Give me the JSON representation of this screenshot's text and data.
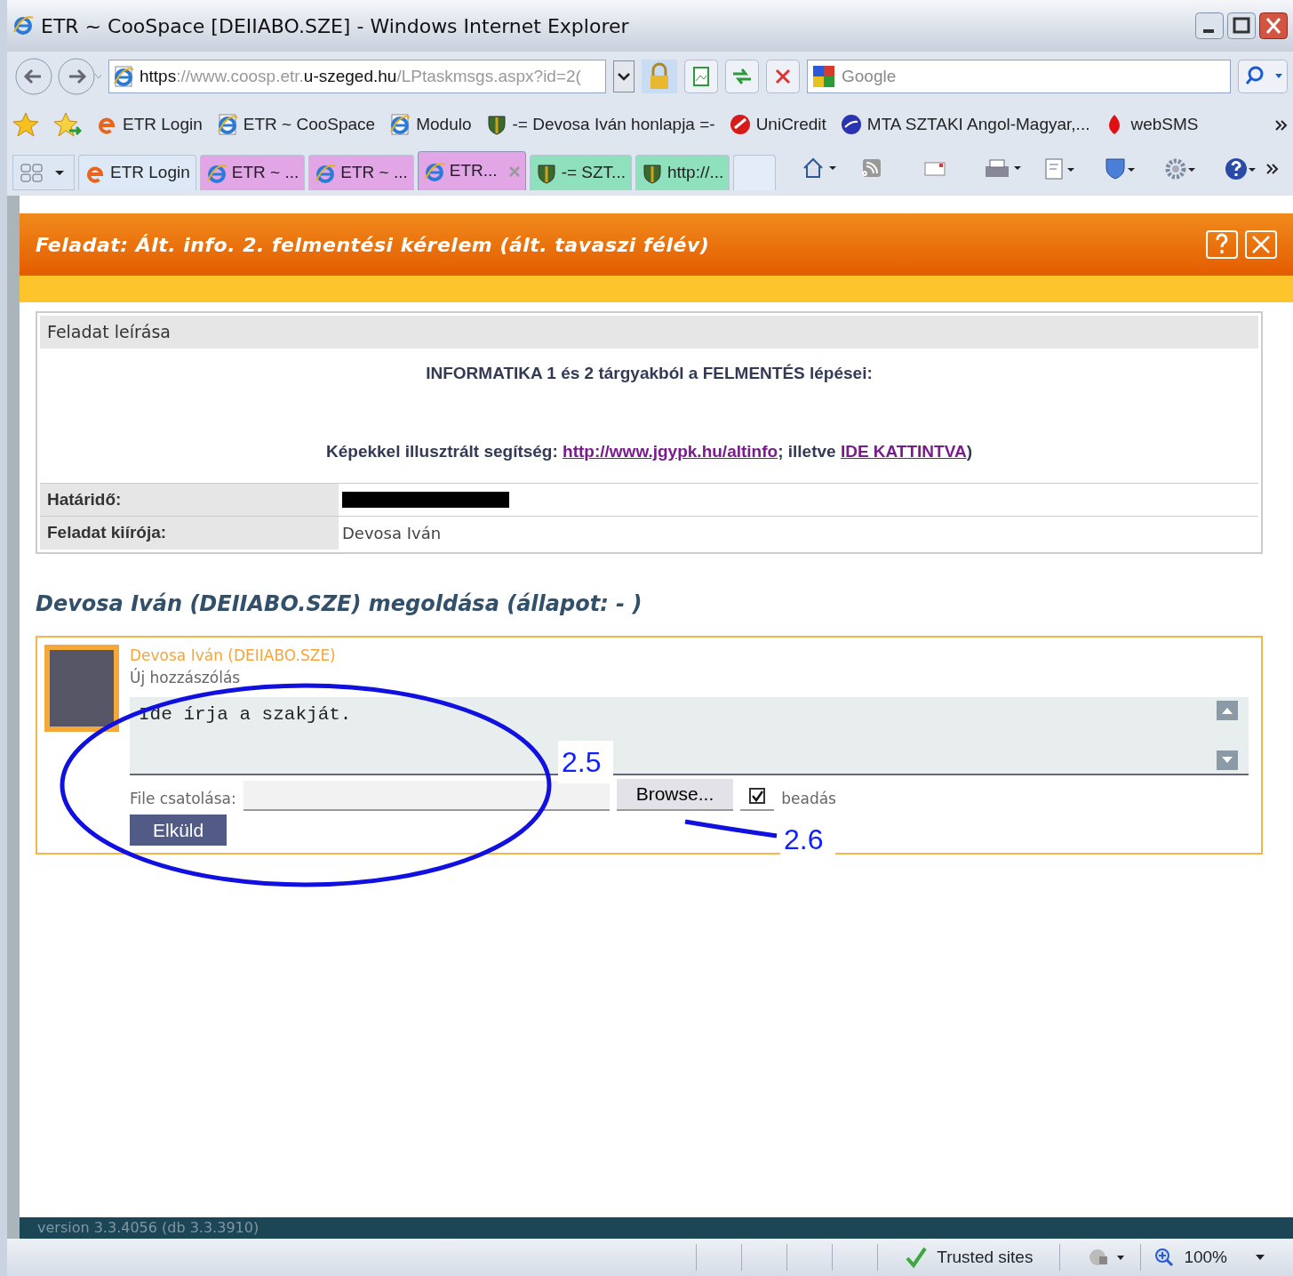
{
  "window": {
    "title": "ETR ~ CooSpace [DEIIABO.SZE] - Windows Internet Explorer"
  },
  "address": {
    "url_parts": [
      {
        "text": "https",
        "dim": false
      },
      {
        "text": "://www.coosp.etr.",
        "dim": true
      },
      {
        "text": "u-szeged.hu",
        "dim": false
      },
      {
        "text": "/LPtaskmsgs.aspx?id=2(",
        "dim": true
      }
    ]
  },
  "search": {
    "placeholder": "Google"
  },
  "favorites": [
    {
      "label": "ETR Login",
      "kind": "ie-orange"
    },
    {
      "label": "ETR ~ CooSpace",
      "kind": "ie-page"
    },
    {
      "label": "Modulo",
      "kind": "ie-page"
    },
    {
      "label": "-= Devosa Iván honlapja =-",
      "kind": "crest"
    },
    {
      "label": "UniCredit",
      "kind": "red-disc"
    },
    {
      "label": "MTA SZTAKI Angol-Magyar,...",
      "kind": "blue-disc"
    },
    {
      "label": "webSMS",
      "kind": "drop"
    }
  ],
  "tabs": [
    {
      "label": "ETR Login",
      "kind": "ie-orange",
      "color": "#dde9f6",
      "selected": false
    },
    {
      "label": "ETR ~ ...",
      "kind": "ie",
      "color": "#e2a6e6",
      "selected": false
    },
    {
      "label": "ETR ~ ...",
      "kind": "ie",
      "color": "#e2a6e6",
      "selected": false
    },
    {
      "label": "ETR...",
      "kind": "ie",
      "color": "#e2a6e6",
      "selected": true
    },
    {
      "label": "-= SZT...",
      "kind": "crest",
      "color": "#8fe0bd",
      "selected": false
    },
    {
      "label": "http://...",
      "kind": "crest",
      "color": "#8fe0bd",
      "selected": false
    }
  ],
  "page": {
    "header": "Feladat: Ált. info. 2. felmentési kérelem (ált. tavaszi félév)",
    "section_title": "Feladat leírása",
    "heading": "INFORMATIKA 1 és 2 tárgyakból a FELMENTÉS lépései:",
    "help": {
      "text": "Képekkel illusztrált segítség:",
      "link": "http://www.jgypk.hu/altinfo",
      "middle": "; illetve",
      "link2": "IDE KATTINTVA",
      "end": ")"
    },
    "fields": [
      {
        "label": "Határidő:",
        "kind": "redacted"
      },
      {
        "label": "Feladat kiírója:",
        "kind": "text",
        "value": "Devosa Iván"
      }
    ],
    "solution_heading": "Devosa Iván (DEIIABO.SZE) megoldása (állapot: - )",
    "post": {
      "author": "Devosa Iván (DEIIABO.SZE)",
      "subtitle": "Új hozzászólás",
      "message": "Ide írja a szakját.",
      "file_label": "File csatolása:",
      "browse": "Browse...",
      "submit_checked": true,
      "submit_label": "beadás",
      "send": "Elküld"
    },
    "annotations": [
      {
        "label": "2.5"
      },
      {
        "label": "2.6"
      }
    ],
    "version": "version 3.3.4056 (db 3.3.3910)"
  },
  "status_bar": {
    "zone": "Trusted sites",
    "zoom": "100%"
  }
}
